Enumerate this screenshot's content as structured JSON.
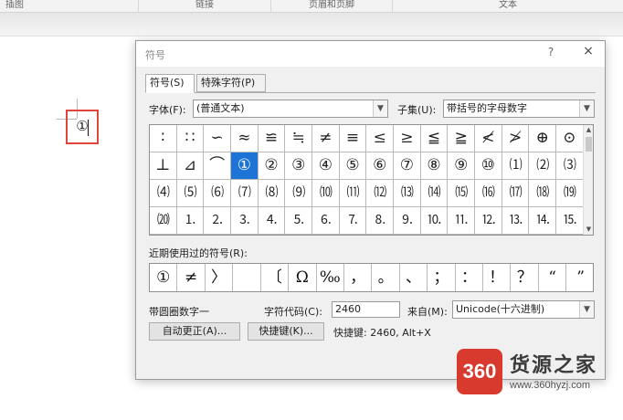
{
  "ribbon": {
    "groups": [
      "插图",
      "链接",
      "页眉和页脚",
      "文本"
    ]
  },
  "document": {
    "inserted_char": "①"
  },
  "dialog": {
    "title": "符号",
    "help": "?",
    "close": "×",
    "tabs": [
      "符号(S)",
      "特殊字符(P)"
    ],
    "font_label": "字体(F):",
    "font_value": "(普通文本)",
    "subset_label": "子集(U):",
    "subset_value": "带括号的字母数字",
    "grid": [
      [
        "∶",
        "∷",
        "∽",
        "≈",
        "≌",
        "≒",
        "≠",
        "≡",
        "≤",
        "≥",
        "≦",
        "≧",
        "≮",
        "≯",
        "⊕",
        "⊙"
      ],
      [
        "⊥",
        "⊿",
        "⌒",
        "①",
        "②",
        "③",
        "④",
        "⑤",
        "⑥",
        "⑦",
        "⑧",
        "⑨",
        "⑩",
        "⑴",
        "⑵",
        "⑶"
      ],
      [
        "⑷",
        "⑸",
        "⑹",
        "⑺",
        "⑻",
        "⑼",
        "⑽",
        "⑾",
        "⑿",
        "⒀",
        "⒁",
        "⒂",
        "⒃",
        "⒄",
        "⒅",
        "⒆"
      ],
      [
        "⒇",
        "⒈",
        "⒉",
        "⒊",
        "⒋",
        "⒌",
        "⒍",
        "⒎",
        "⒏",
        "⒐",
        "⒑",
        "⒒",
        "⒓",
        "⒔",
        "⒕",
        "⒖"
      ]
    ],
    "selected_symbol": "①",
    "recent_label": "近期使用过的符号(R):",
    "recent": [
      "①",
      "≠",
      "〉",
      "",
      "〔",
      "Ω",
      "‰",
      "，",
      "。",
      "、",
      "；",
      "：",
      "！",
      "？",
      "“",
      "”",
      "（"
    ],
    "char_name": "带圆圈数字一",
    "code_label": "字符代码(C):",
    "code_value": "2460",
    "from_label": "来自(M):",
    "from_value": "Unicode(十六进制)",
    "autocorrect_button": "自动更正(A)...",
    "shortcut_button": "快捷键(K)...",
    "shortcut_text": "快捷键: 2460, Alt+X"
  },
  "watermark": {
    "badge": "360",
    "name": "货源之家",
    "url": "www.360hyzj.com"
  },
  "colors": {
    "selection": "#1e74d6",
    "highlight_border": "#e0443a",
    "watermark_red": "#d93a2e"
  }
}
